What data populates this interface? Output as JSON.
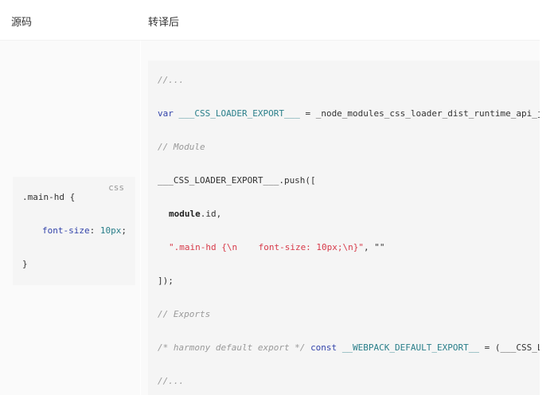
{
  "table": {
    "headers": [
      "源码",
      "转译后"
    ]
  },
  "source": {
    "lang": "css",
    "selector": ".main-hd",
    "open_brace": "{",
    "prop": "font-size",
    "colon": ":",
    "value": "10px",
    "semicolon": ";",
    "close_brace": "}"
  },
  "transpiled": {
    "l1": "//...",
    "l2_kw": "var",
    "l2_var": "___CSS_LOADER_EXPORT___",
    "l2_rest": " = _node_modules_css_loader_dist_runtime_api_j",
    "l3": "// Module",
    "l4": "___CSS_LOADER_EXPORT___.push([",
    "l5_bold": "module",
    "l5_rest": ".id,",
    "l6_str": "\".main-hd {\\n    font-size: 10px;\\n}\"",
    "l6_rest": ", \"\"",
    "l7": "]);",
    "l8": "// Exports",
    "l9_cmt": "/* harmony default export */",
    "l9_kw": "const",
    "l9_var": "__WEBPACK_DEFAULT_EXPORT__",
    "l9_rest": " = (___CSS_L",
    "l10": "//..."
  }
}
